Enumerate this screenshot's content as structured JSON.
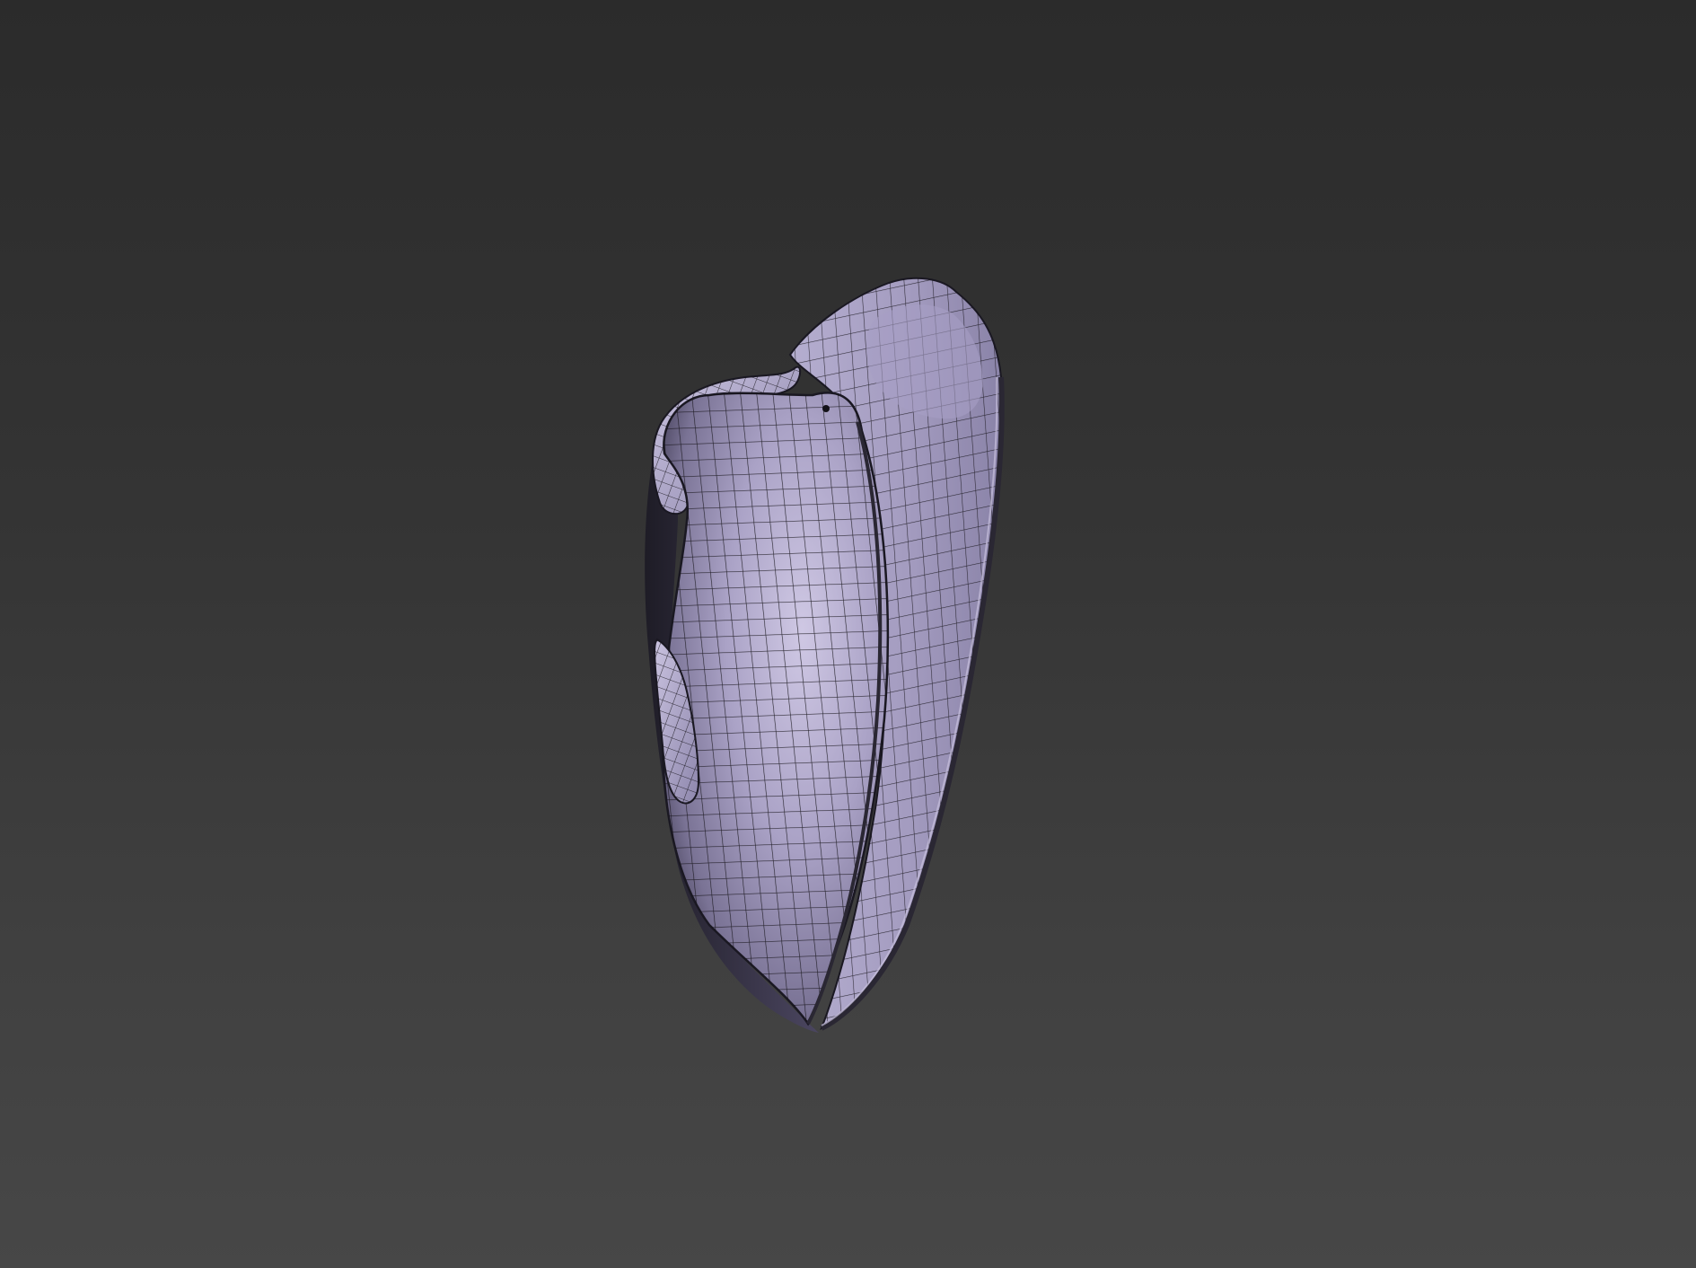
{
  "viewport": {
    "shading_mode": "smooth-with-wireframe-edges",
    "colors": {
      "background_top": "#2b2b2b",
      "background_bottom": "#474747",
      "surface": "#a79fc2",
      "surface_shadow": "#5d5773",
      "surface_highlight": "#d3cde6",
      "wireframe": "#111111"
    },
    "object": {
      "kind": "subdivided-mesh",
      "description_icon": "mesh-object-icon"
    }
  }
}
